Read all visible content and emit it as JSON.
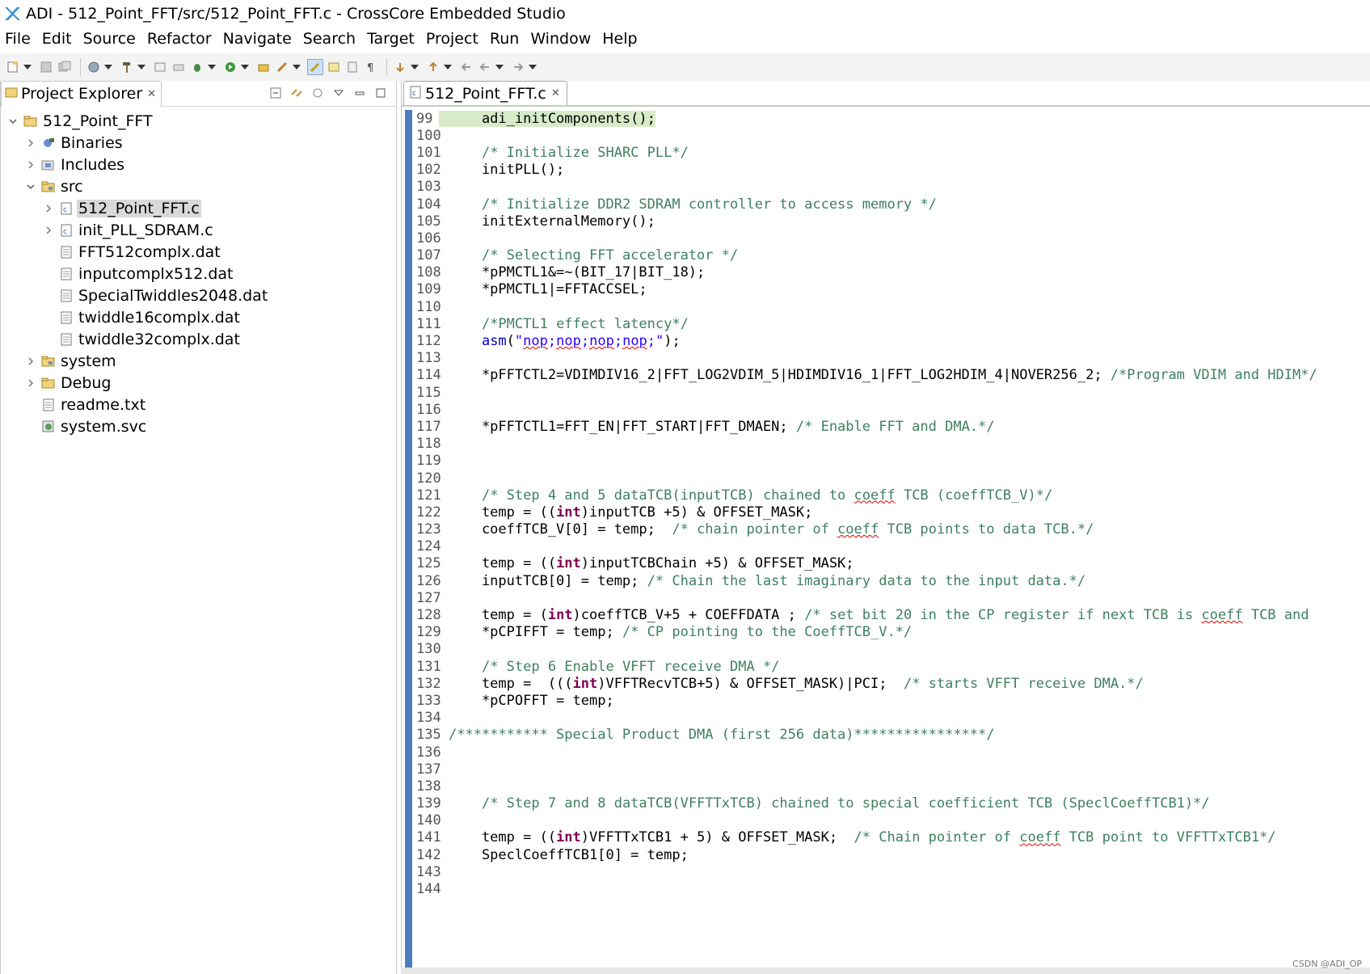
{
  "window": {
    "title": "ADI - 512_Point_FFT/src/512_Point_FFT.c - CrossCore Embedded Studio"
  },
  "menu": [
    "File",
    "Edit",
    "Source",
    "Refactor",
    "Navigate",
    "Search",
    "Target",
    "Project",
    "Run",
    "Window",
    "Help"
  ],
  "explorer": {
    "tab_label": "Project Explorer",
    "tree": [
      {
        "label": "512_Point_FFT",
        "icon": "project-icon",
        "twisty": "expanded",
        "level": 0
      },
      {
        "label": "Binaries",
        "icon": "binaries-icon",
        "twisty": "collapsed",
        "level": 1
      },
      {
        "label": "Includes",
        "icon": "includes-icon",
        "twisty": "collapsed",
        "level": 1
      },
      {
        "label": "src",
        "icon": "source-folder-icon",
        "twisty": "expanded",
        "level": 1
      },
      {
        "label": "512_Point_FFT.c",
        "icon": "c-file-icon",
        "twisty": "collapsed",
        "level": 2,
        "selected": true
      },
      {
        "label": "init_PLL_SDRAM.c",
        "icon": "c-file-icon",
        "twisty": "collapsed",
        "level": 2
      },
      {
        "label": "FFT512complx.dat",
        "icon": "text-file-icon",
        "twisty": "none",
        "level": 2
      },
      {
        "label": "inputcomplx512.dat",
        "icon": "text-file-icon",
        "twisty": "none",
        "level": 2
      },
      {
        "label": "SpecialTwiddles2048.dat",
        "icon": "text-file-icon",
        "twisty": "none",
        "level": 2
      },
      {
        "label": "twiddle16complx.dat",
        "icon": "text-file-icon",
        "twisty": "none",
        "level": 2
      },
      {
        "label": "twiddle32complx.dat",
        "icon": "text-file-icon",
        "twisty": "none",
        "level": 2
      },
      {
        "label": "system",
        "icon": "source-folder-icon",
        "twisty": "collapsed",
        "level": 1
      },
      {
        "label": "Debug",
        "icon": "folder-icon",
        "twisty": "collapsed",
        "level": 1
      },
      {
        "label": "readme.txt",
        "icon": "text-file-icon",
        "twisty": "none",
        "level": 1
      },
      {
        "label": "system.svc",
        "icon": "svc-file-icon",
        "twisty": "none",
        "level": 1
      }
    ]
  },
  "editor": {
    "tab_label": "512_Point_FFT.c",
    "lines": [
      {
        "n": "99",
        "code": "    adi_initComponents();",
        "current": true
      },
      {
        "n": "100",
        "code": ""
      },
      {
        "n": "101",
        "code": "    /* Initialize SHARC PLL*/"
      },
      {
        "n": "102",
        "code": "    initPLL();"
      },
      {
        "n": "103",
        "code": ""
      },
      {
        "n": "104",
        "code": "    /* Initialize DDR2 SDRAM controller to access memory */"
      },
      {
        "n": "105",
        "code": "    initExternalMemory();"
      },
      {
        "n": "106",
        "code": ""
      },
      {
        "n": "107",
        "code": "    /* Selecting FFT accelerator */"
      },
      {
        "n": "108",
        "code": "    *pPMCTL1&=~(BIT_17|BIT_18);"
      },
      {
        "n": "109",
        "code": "    *pPMCTL1|=FFTACCSEL;"
      },
      {
        "n": "110",
        "code": ""
      },
      {
        "n": "111",
        "code": "    /*PMCTL1 effect latency*/"
      },
      {
        "n": "112",
        "code": "    asm(\"nop;nop;nop;nop;\");"
      },
      {
        "n": "113",
        "code": ""
      },
      {
        "n": "114",
        "code": "    *pFFTCTL2=VDIMDIV16_2|FFT_LOG2VDIM_5|HDIMDIV16_1|FFT_LOG2HDIM_4|NOVER256_2; /*Program VDIM and HDIM*/"
      },
      {
        "n": "115",
        "code": ""
      },
      {
        "n": "116",
        "code": ""
      },
      {
        "n": "117",
        "code": "    *pFFTCTL1=FFT_EN|FFT_START|FFT_DMAEN; /* Enable FFT and DMA.*/"
      },
      {
        "n": "118",
        "code": ""
      },
      {
        "n": "119",
        "code": ""
      },
      {
        "n": "120",
        "code": ""
      },
      {
        "n": "121",
        "code": "    /* Step 4 and 5 dataTCB(inputTCB) chained to coeff TCB (coeffTCB_V)*/"
      },
      {
        "n": "122",
        "code": "    temp = ((int)inputTCB +5) & OFFSET_MASK;"
      },
      {
        "n": "123",
        "code": "    coeffTCB_V[0] = temp;  /* chain pointer of coeff TCB points to data TCB.*/"
      },
      {
        "n": "124",
        "code": ""
      },
      {
        "n": "125",
        "code": "    temp = ((int)inputTCBChain +5) & OFFSET_MASK;"
      },
      {
        "n": "126",
        "code": "    inputTCB[0] = temp; /* Chain the last imaginary data to the input data.*/"
      },
      {
        "n": "127",
        "code": ""
      },
      {
        "n": "128",
        "code": "    temp = (int)coeffTCB_V+5 + COEFFDATA ; /* set bit 20 in the CP register if next TCB is coeff TCB and"
      },
      {
        "n": "129",
        "code": "    *pCPIFFT = temp; /* CP pointing to the CoeffTCB_V.*/"
      },
      {
        "n": "130",
        "code": ""
      },
      {
        "n": "131",
        "code": "    /* Step 6 Enable VFFT receive DMA */"
      },
      {
        "n": "132",
        "code": "    temp =  (((int)VFFTRecvTCB+5) & OFFSET_MASK)|PCI;  /* starts VFFT receive DMA.*/"
      },
      {
        "n": "133",
        "code": "    *pCPOFFT = temp;"
      },
      {
        "n": "134",
        "code": ""
      },
      {
        "n": "135",
        "code": "/*********** Special Product DMA (first 256 data)****************/"
      },
      {
        "n": "136",
        "code": ""
      },
      {
        "n": "137",
        "code": ""
      },
      {
        "n": "138",
        "code": ""
      },
      {
        "n": "139",
        "code": "    /* Step 7 and 8 dataTCB(VFFTTxTCB) chained to special coefficient TCB (SpeclCoeffTCB1)*/"
      },
      {
        "n": "140",
        "code": ""
      },
      {
        "n": "141",
        "code": "    temp = ((int)VFFTTxTCB1 + 5) & OFFSET_MASK;  /* Chain pointer of coeff TCB point to VFFTTxTCB1*/"
      },
      {
        "n": "142",
        "code": "    SpeclCoeffTCB1[0] = temp;"
      },
      {
        "n": "143",
        "code": ""
      },
      {
        "n": "144",
        "code": ""
      }
    ]
  },
  "watermark": "CSDN @ADI_OP",
  "colors": {
    "comment": "#3f7f5f",
    "keyword": "#7f0055",
    "string": "#2a00ff",
    "gutter_marker": "#4a7ebf",
    "current_line": "#d6ebc8",
    "selection": "#d9d9d9"
  }
}
